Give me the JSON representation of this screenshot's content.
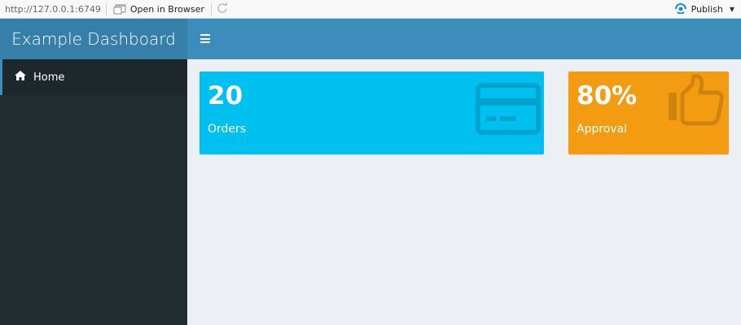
{
  "viewer": {
    "url": "http://127.0.0.1:6749",
    "open_browser": "Open in Browser",
    "publish": "Publish"
  },
  "header": {
    "title": "Example Dashboard"
  },
  "sidebar": {
    "items": [
      {
        "label": "Home",
        "icon": "home-icon"
      }
    ]
  },
  "boxes": {
    "orders": {
      "value": "20",
      "label": "Orders",
      "icon": "credit-card-icon",
      "color": "#00c0ef"
    },
    "approval": {
      "value": "80%",
      "label": "Approval",
      "icon": "thumbs-up-icon",
      "color": "#f39c12"
    }
  },
  "colors": {
    "navbar": "#3c8dbc",
    "logo": "#367fa9",
    "sidebar": "#222d32",
    "content_bg": "#ecf0f5"
  }
}
